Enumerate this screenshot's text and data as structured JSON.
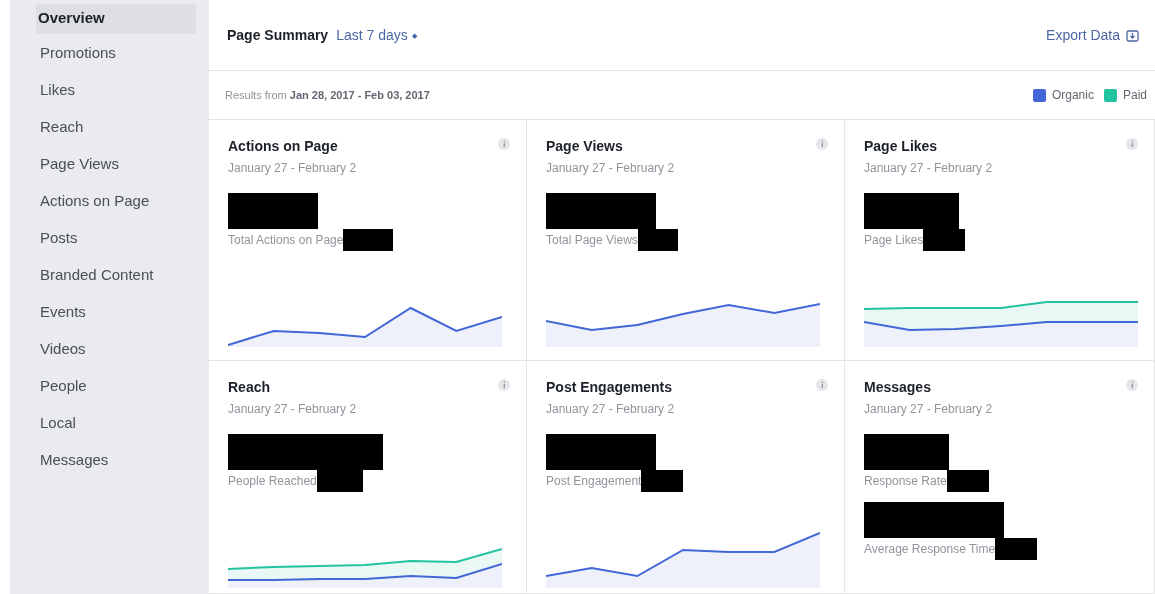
{
  "sidebar": {
    "items": [
      {
        "label": "Overview",
        "selected": true
      },
      {
        "label": "Promotions",
        "selected": false
      },
      {
        "label": "Likes",
        "selected": false
      },
      {
        "label": "Reach",
        "selected": false
      },
      {
        "label": "Page Views",
        "selected": false
      },
      {
        "label": "Actions on Page",
        "selected": false
      },
      {
        "label": "Posts",
        "selected": false
      },
      {
        "label": "Branded Content",
        "selected": false
      },
      {
        "label": "Events",
        "selected": false
      },
      {
        "label": "Videos",
        "selected": false
      },
      {
        "label": "People",
        "selected": false
      },
      {
        "label": "Local",
        "selected": false
      },
      {
        "label": "Messages",
        "selected": false
      }
    ]
  },
  "header": {
    "title": "Page Summary",
    "period": "Last 7 days",
    "period_caret": "◆",
    "export": "Export Data"
  },
  "results": {
    "prefix": "Results from",
    "range": "Jan 28, 2017 - Feb 03, 2017"
  },
  "legend": [
    {
      "name": "Organic",
      "color": "#4267d6"
    },
    {
      "name": "Paid",
      "color": "#23c3a0"
    }
  ],
  "cards": [
    {
      "kind": "chart",
      "title": "Actions on Page",
      "dates": "January 27 - February 2",
      "metrics": [
        "Total Actions on Page"
      ]
    },
    {
      "kind": "chart",
      "title": "Page Views",
      "dates": "January 27 - February 2",
      "metrics": [
        "Total Page Views"
      ]
    },
    {
      "kind": "chart",
      "title": "Page Likes",
      "dates": "January 27 - February 2",
      "metrics": [
        "Page Likes"
      ]
    },
    {
      "kind": "chart",
      "title": "Reach",
      "dates": "January 27 - February 2",
      "metrics": [
        "People Reached"
      ]
    },
    {
      "kind": "chart",
      "title": "Post Engagements",
      "dates": "January 27 - February 2",
      "metrics": [
        "Post Engagement"
      ]
    },
    {
      "kind": "metrics",
      "title": "Messages",
      "dates": "January 27 - February 2",
      "metrics": [
        "Response Rate",
        "Average Response Time"
      ]
    }
  ]
}
